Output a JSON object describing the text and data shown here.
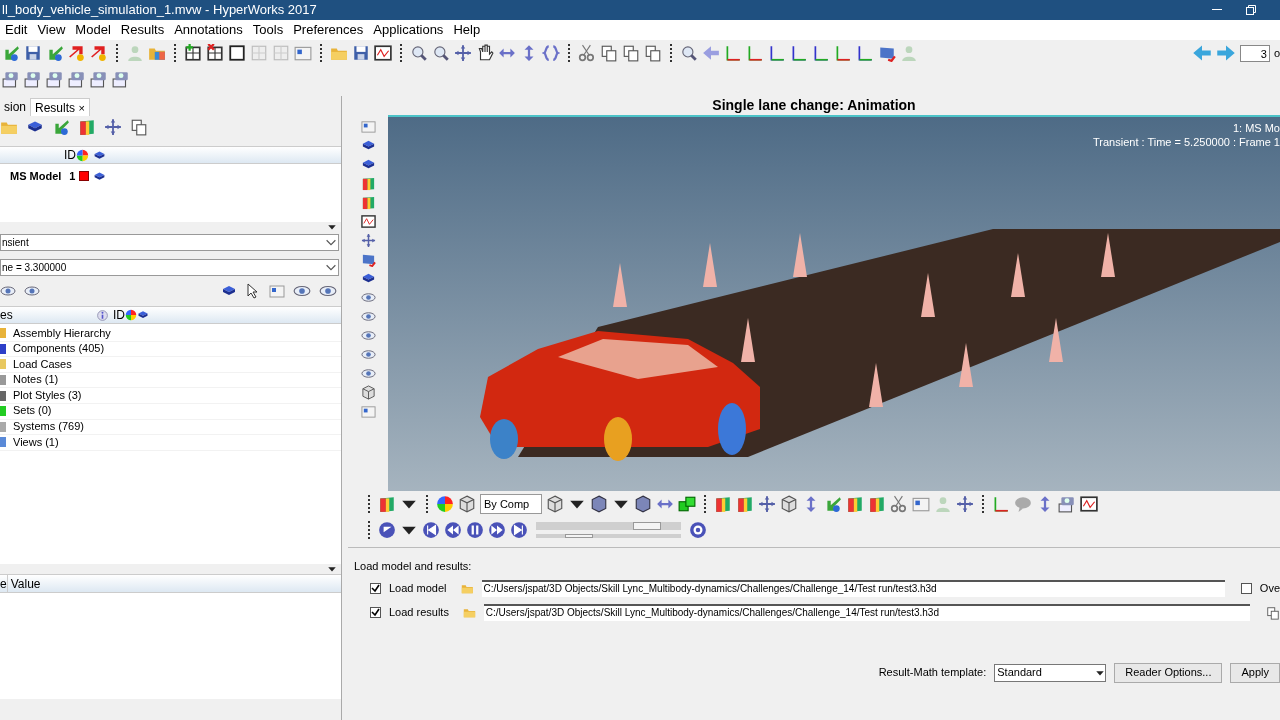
{
  "window": {
    "title": "ll_body_vehicle_simulation_1.mvw - HyperWorks 2017"
  },
  "menu": [
    "Edit",
    "View",
    "Model",
    "Results",
    "Annotations",
    "Tools",
    "Preferences",
    "Applications",
    "Help"
  ],
  "page_field": {
    "value": "3",
    "suffix": "o"
  },
  "browser": {
    "tabs": [
      {
        "label": "sion",
        "selected": false
      },
      {
        "label": "Results",
        "selected": true,
        "close": "×"
      }
    ],
    "model_table": {
      "columns": [
        "ID"
      ],
      "rows": [
        {
          "name": "MS Model",
          "id": "1",
          "color": "#ff0000"
        }
      ]
    },
    "result_type": "nsient",
    "time_step": "ne = 3.300000",
    "tree": {
      "columns": [
        "es",
        "ID"
      ],
      "items": [
        {
          "label": "Assembly Hierarchy"
        },
        {
          "label": "Components (405)"
        },
        {
          "label": "Load Cases"
        },
        {
          "label": "Notes (1)"
        },
        {
          "label": "Plot Styles (3)"
        },
        {
          "label": "Sets  (0)"
        },
        {
          "label": "Systems (769)"
        },
        {
          "label": "Views (1)"
        }
      ]
    },
    "properties": {
      "columns": [
        "e",
        "Value"
      ]
    }
  },
  "view": {
    "title": "Single lane change: Animation",
    "overlay": [
      "1: MS Mo",
      "Transient : Time = 5.250000 : Frame 1"
    ],
    "color_mode": "By Comp",
    "animation": {
      "level": 0.83
    },
    "speed": {
      "level": 0.25
    }
  },
  "load": {
    "heading": "Load model and results:",
    "rows": [
      {
        "label": "Load model",
        "checked": true,
        "path": "C:/Users/jspat/3D Objects/Skill Lync_Multibody-dynamics/Challenges/Challenge_14/Test run/test3.h3d"
      },
      {
        "label": "Load results",
        "checked": true,
        "path": "C:/Users/jspat/3D Objects/Skill Lync_Multibody-dynamics/Challenges/Challenge_14/Test run/test3.h3d"
      }
    ],
    "overlay_option": {
      "label": "Ove",
      "checked": false
    },
    "template_label": "Result-Math template:",
    "template": "Standard",
    "buttons": [
      "Reader Options...",
      "Apply"
    ]
  }
}
